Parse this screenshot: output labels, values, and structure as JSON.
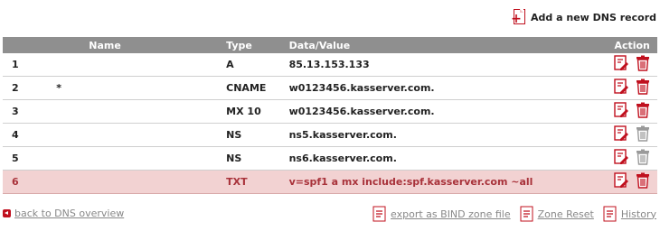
{
  "add_record_label": "Add a new DNS record",
  "table": {
    "headers": {
      "name": "Name",
      "type": "Type",
      "data": "Data/Value",
      "action": "Action"
    },
    "rows": [
      {
        "index": "1",
        "name": "",
        "type": "A",
        "data": "85.13.153.133",
        "highlighted": false
      },
      {
        "index": "2",
        "name": "*",
        "type": "CNAME",
        "data": "w0123456.kasserver.com.",
        "highlighted": false
      },
      {
        "index": "3",
        "name": "",
        "type": "MX 10",
        "data": "w0123456.kasserver.com.",
        "highlighted": false
      },
      {
        "index": "4",
        "name": "",
        "type": "NS",
        "data": "ns5.kasserver.com.",
        "highlighted": false
      },
      {
        "index": "5",
        "name": "",
        "type": "NS",
        "data": "ns6.kasserver.com.",
        "highlighted": false
      },
      {
        "index": "6",
        "name": "",
        "type": "TXT",
        "data": "v=spf1 a mx include:spf.kasserver.com ~all",
        "highlighted": true
      }
    ]
  },
  "footer": {
    "back_label": "back to DNS overview",
    "export_label": "export as BIND zone file",
    "reset_label": "Zone Reset",
    "history_label": "History"
  },
  "colors": {
    "accent": "#c0101e",
    "header_bg": "#8f8f8f",
    "highlight_bg": "#f2d2d2",
    "highlight_text": "#a8323a"
  },
  "icons": {
    "add": "add-document-icon",
    "edit": "edit-icon",
    "delete": "trash-icon",
    "back": "back-arrow-icon",
    "export": "document-icon"
  }
}
